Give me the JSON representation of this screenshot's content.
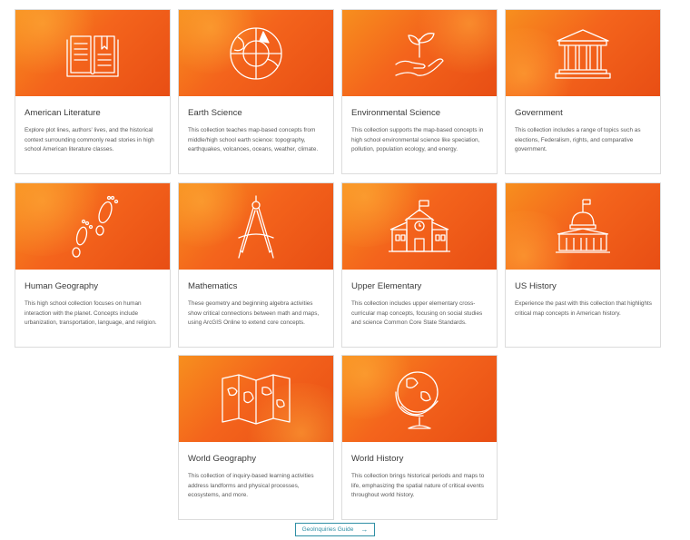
{
  "cards": [
    {
      "title": "American Literature",
      "description": "Explore plot lines, authors' lives, and the historical context surrounding commonly read stories in high school American literature classes.",
      "icon": "book-icon"
    },
    {
      "title": "Earth Science",
      "description": "This collection teaches map-based concepts from middle/high school earth science: topography, earthquakes, volcanoes, oceans, weather, climate.",
      "icon": "earth-globe-icon"
    },
    {
      "title": "Environmental Science",
      "description": "This collection supports the map-based concepts in high school environmental science like speciation, pollution, population ecology, and energy.",
      "icon": "hand-seedling-icon"
    },
    {
      "title": "Government",
      "description": "This collection includes a range of topics such as elections, Federalism, rights, and comparative government.",
      "icon": "government-building-icon"
    },
    {
      "title": "Human Geography",
      "description": "This high school collection focuses on human interaction with the planet. Concepts include urbanization, transportation, language, and religion.",
      "icon": "footprints-icon"
    },
    {
      "title": "Mathematics",
      "description": "These geometry and beginning algebra activities show critical connections between math and maps, using ArcGIS Online to extend core concepts.",
      "icon": "compass-icon"
    },
    {
      "title": "Upper Elementary",
      "description": "This collection includes upper elementary cross-curricular map concepts, focusing on social studies and science Common Core State Standards.",
      "icon": "schoolhouse-icon"
    },
    {
      "title": "US History",
      "description": "Experience the past with this collection that highlights critical map concepts in American history.",
      "icon": "capitol-icon"
    },
    {
      "title": "World Geography",
      "description": "This collection of inquiry-based learning activities address landforms and physical processes, ecosystems, and more.",
      "icon": "folded-map-icon"
    },
    {
      "title": "World History",
      "description": "This collection brings historical periods and maps to life, emphasizing the spatial nature of critical events throughout world history.",
      "icon": "desk-globe-icon"
    }
  ],
  "guide_button": {
    "label": "GeoInquiries Guide",
    "arrow": "→"
  },
  "colors": {
    "accent": "#2f8fa5",
    "thumb_start": "#f78f1e",
    "thumb_end": "#e84e14"
  }
}
